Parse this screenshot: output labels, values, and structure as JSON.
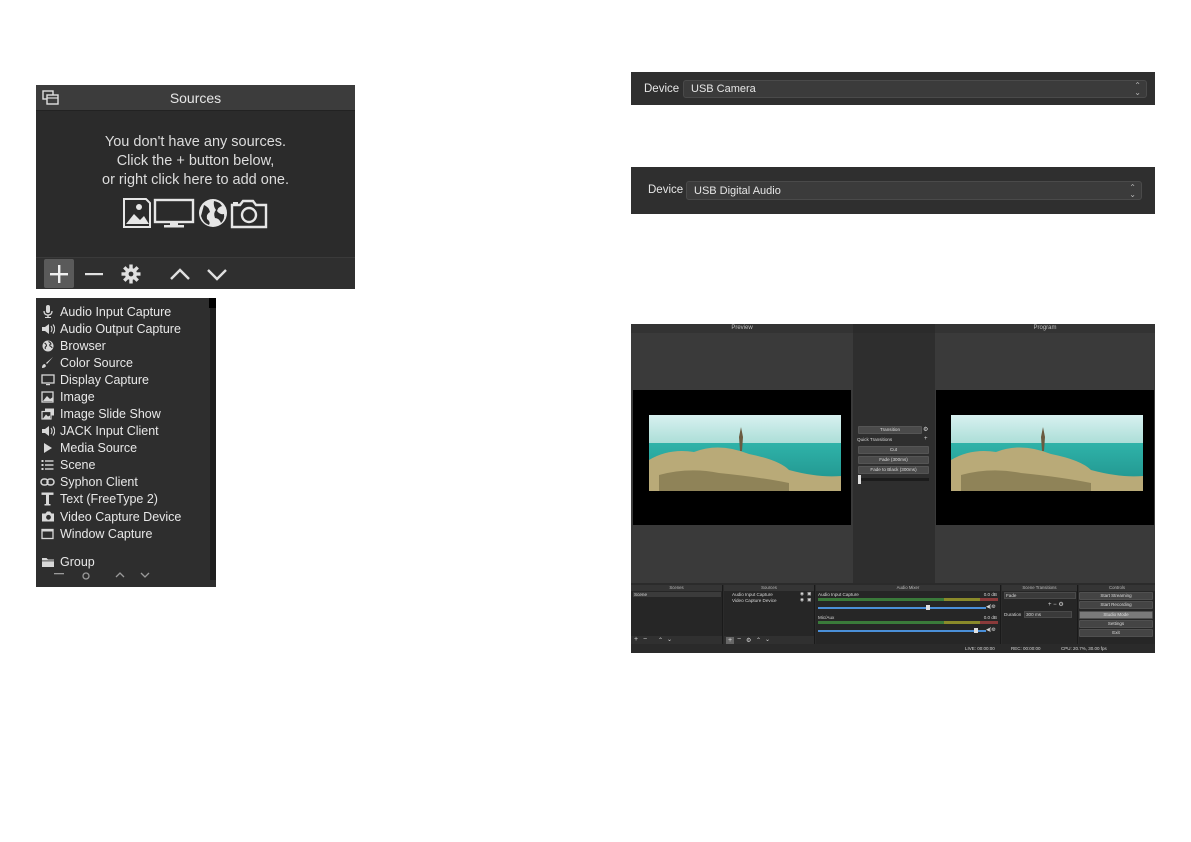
{
  "sources_panel": {
    "title": "Sources",
    "empty_message": [
      "You don't have any sources.",
      "Click the + button below,",
      "or right click here to add one."
    ],
    "toolbar": {
      "add_icon": "plus-icon",
      "remove_icon": "minus-icon",
      "properties_icon": "gear-icon",
      "move_up_icon": "chevron-up-icon",
      "move_down_icon": "chevron-down-icon"
    }
  },
  "add_source_menu": {
    "items": [
      {
        "label": "Audio Input Capture",
        "icon": "microphone-icon"
      },
      {
        "label": "Audio Output Capture",
        "icon": "speaker-icon"
      },
      {
        "label": "Browser",
        "icon": "globe-icon"
      },
      {
        "label": "Color Source",
        "icon": "brush-icon"
      },
      {
        "label": "Display Capture",
        "icon": "monitor-icon"
      },
      {
        "label": "Image",
        "icon": "image-icon"
      },
      {
        "label": "Image Slide Show",
        "icon": "slideshow-icon"
      },
      {
        "label": "JACK Input Client",
        "icon": "speaker-icon"
      },
      {
        "label": "Media Source",
        "icon": "play-icon"
      },
      {
        "label": "Scene",
        "icon": "list-icon"
      },
      {
        "label": "Syphon Client",
        "icon": "link-icon"
      },
      {
        "label": "Text (FreeType 2)",
        "icon": "text-icon"
      },
      {
        "label": "Video Capture Device",
        "icon": "camera-icon"
      },
      {
        "label": "Window Capture",
        "icon": "window-icon"
      }
    ],
    "group": {
      "label": "Group",
      "icon": "folder-icon"
    }
  },
  "video_device": {
    "label": "Device",
    "value": "USB Camera"
  },
  "audio_device": {
    "label": "Device",
    "value": "USB Digital Audio"
  },
  "obs": {
    "preview_title": "Preview",
    "program_title": "Program",
    "transition_button": "Transition",
    "quick_transitions": "Quick Transitions",
    "cut": "Cut",
    "fade_300": "Fade (300ms)",
    "fade_black": "Fade to Black (300ms)",
    "docks": {
      "scenes": "Scenes",
      "sources": "Sources",
      "mixer": "Audio Mixer",
      "transitions": "Scene Transitions",
      "controls": "Controls"
    },
    "scene_item": "Scene",
    "source_items": [
      "Audio Input Capture",
      "Video Capture Device"
    ],
    "mixer": {
      "channel1": "Audio Input Capture",
      "channel1_db": "0.0 dB",
      "channel2": "Mic/Aux",
      "channel2_db": "0.0 dB"
    },
    "transition_select": "Fade",
    "duration_label": "Duration",
    "duration_value": "300 ms",
    "controls": [
      "Start Streaming",
      "Start Recording",
      "Studio Mode",
      "Settings",
      "Exit"
    ],
    "status": {
      "live": "LIVE: 00:00:00",
      "rec": "REC: 00:00:00",
      "cpu": "CPU: 20.7%, 30.00 fps"
    }
  }
}
